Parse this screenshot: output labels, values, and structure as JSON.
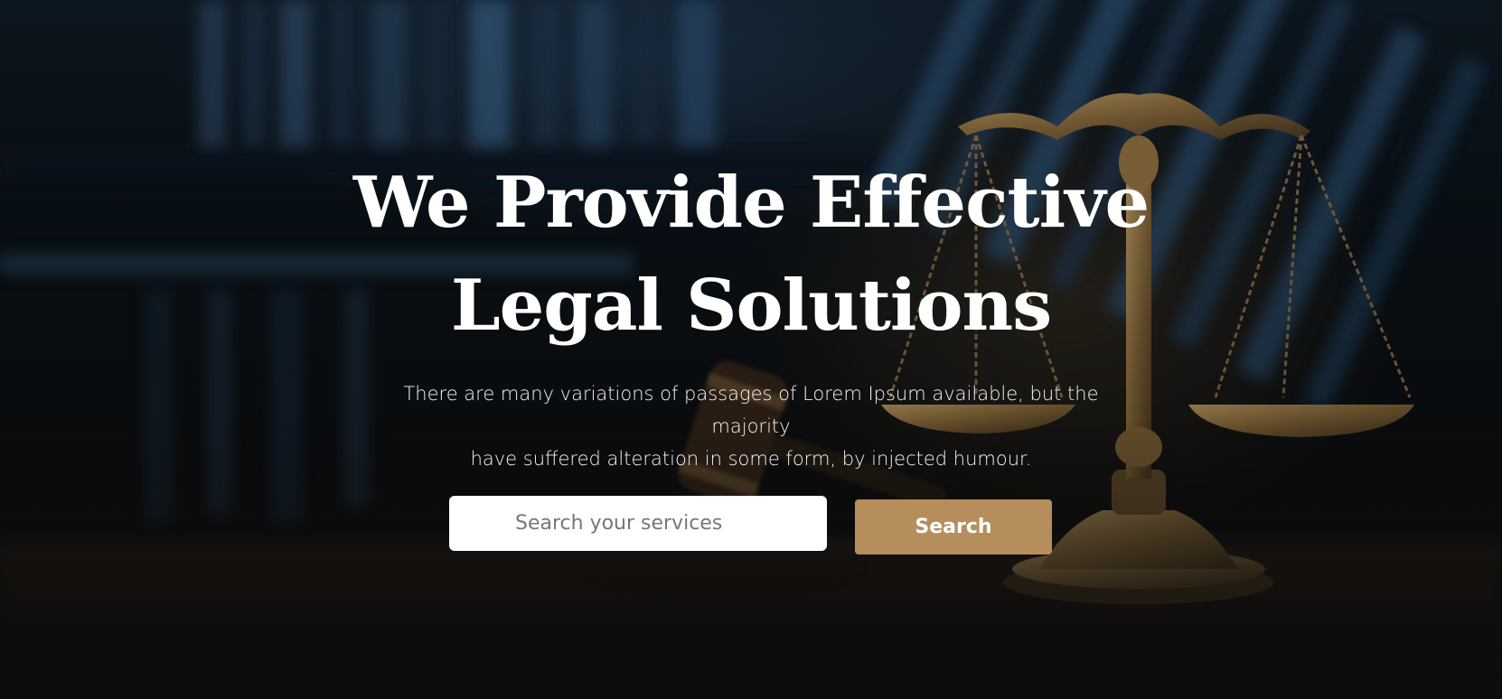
{
  "hero": {
    "headline_line1": "We Provide Effective",
    "headline_line2": "Legal Solutions",
    "subtext_line1": "There are many variations of passages of Lorem Ipsum available, but the majority",
    "subtext_line2": "have suffered alteration in some form, by injected humour."
  },
  "search": {
    "placeholder": "Search your services",
    "value": "",
    "button_label": "Search"
  },
  "colors": {
    "accent": "#b58e5c",
    "text": "#ffffff",
    "background": "#0d0f12"
  },
  "background_image": {
    "depicts": [
      "scales-of-justice",
      "gavel",
      "bookshelves"
    ]
  }
}
